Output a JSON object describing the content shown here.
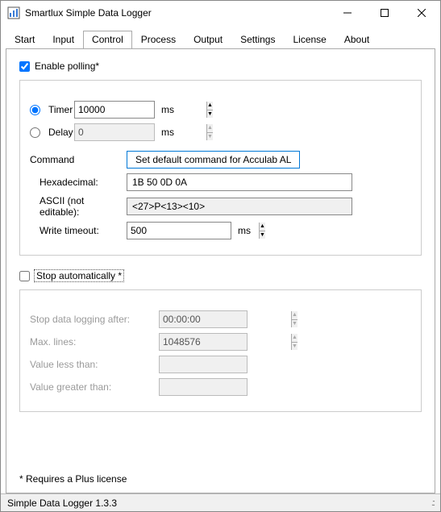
{
  "window": {
    "title": "Smartlux Simple Data Logger"
  },
  "tabs": [
    "Start",
    "Input",
    "Control",
    "Process",
    "Output",
    "Settings",
    "License",
    "About"
  ],
  "active_tab": 2,
  "polling": {
    "enable_label": "Enable polling*",
    "enable_checked": true,
    "timer_label": "Timer",
    "timer_value": "10000",
    "delay_label": "Delay",
    "delay_value": "0",
    "unit": "ms",
    "command_label": "Command",
    "set_default_button": "Set default command for Acculab AL",
    "hex_label": "Hexadecimal:",
    "hex_value": "1B 50 0D 0A",
    "ascii_label": "ASCII (not editable):",
    "ascii_value": "<27>P<13><10>",
    "timeout_label": "Write timeout:",
    "timeout_value": "500"
  },
  "stop": {
    "label": "Stop automatically *",
    "checked": false,
    "after_label": "Stop data logging after:",
    "after_value": "00:00:00",
    "maxlines_label": "Max. lines:",
    "maxlines_value": "1048576",
    "less_label": "Value less than:",
    "less_value": "",
    "greater_label": "Value greater than:",
    "greater_value": ""
  },
  "footnote": "* Requires a Plus license",
  "status": "Simple Data Logger 1.3.3"
}
